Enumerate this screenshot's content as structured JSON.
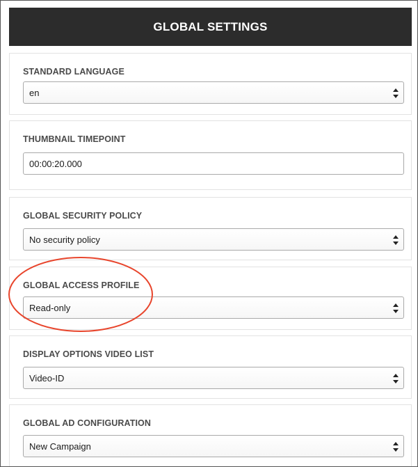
{
  "header": {
    "title": "GLOBAL SETTINGS"
  },
  "panels": {
    "standard_language": {
      "label": "STANDARD LANGUAGE",
      "value": "en"
    },
    "thumbnail_timepoint": {
      "label": "THUMBNAIL TIMEPOINT",
      "value": "00:00:20.000"
    },
    "global_security_policy": {
      "label": "GLOBAL SECURITY POLICY",
      "value": "No security policy"
    },
    "global_access_profile": {
      "label": "GLOBAL ACCESS PROFILE",
      "value": "Read-only"
    },
    "display_options_video_list": {
      "label": "DISPLAY OPTIONS VIDEO LIST",
      "value": "Video-ID"
    },
    "global_ad_configuration": {
      "label": "GLOBAL AD CONFIGURATION",
      "value": "New Campaign"
    }
  },
  "annotation": {
    "color": "#e8452c",
    "shape": "ellipse",
    "target": "global_access_profile"
  },
  "icons": {
    "select_arrows": "up-down-arrows-icon"
  }
}
